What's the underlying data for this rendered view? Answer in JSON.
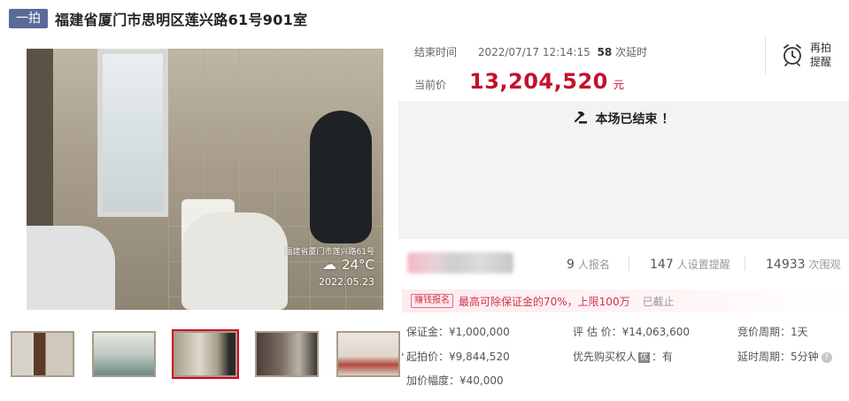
{
  "header": {
    "badge": "一拍",
    "title": "福建省厦门市思明区莲兴路61号901室"
  },
  "photo": {
    "watermark_address": "福建省厦门市莲兴路61号",
    "weather_icon": "cloud-icon",
    "temperature": "24°C",
    "date": "2022.05.23"
  },
  "thumbnails": {
    "count": 5,
    "active_index": 2
  },
  "auction": {
    "end_time_label": "结束时间",
    "end_time": "2022/07/17 12:14:15",
    "delay_count": "58",
    "delay_label": "次延时",
    "current_price_label": "当前价",
    "current_price": "13,204,520",
    "currency_unit": "元",
    "reminder_line1": "再拍",
    "reminder_line2": "提醒",
    "ended_message": "本场已结束 ！"
  },
  "stats": {
    "signups": "9",
    "signups_label": "人报名",
    "reminders": "147",
    "reminders_label": "人设置提醒",
    "views": "14933",
    "views_label": "次围观"
  },
  "promo": {
    "tag": "赚钱报名",
    "text": "最高可除保证金的70%，上限100万",
    "status": "已截止"
  },
  "info": {
    "deposit": "保证金：¥1,000,000",
    "start_price": "起拍价：¥9,844,520",
    "increment": "加价幅度：¥40,000",
    "appraisal": "评 估 价：¥14,063,600",
    "priority_prefix": "优先购买权人",
    "priority_badge": "优",
    "priority_suffix": "：有",
    "bid_period": "竞价周期：1天",
    "delay_period": "延时周期：5分钟"
  },
  "colors": {
    "price_red": "#c4112c",
    "badge_blue": "#5a6b9a",
    "active_thumb_border": "#d6001c"
  }
}
